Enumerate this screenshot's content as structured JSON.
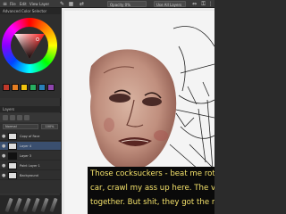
{
  "toolbar": {
    "items": [
      "File",
      "Edit",
      "View",
      "Layer"
    ],
    "opacity_label": "Opacity 0%",
    "mode_label": "Use All Layers"
  },
  "left_panel": {
    "color_header": "Advanced Color Selector",
    "layers_header": "Layers",
    "blend_mode": "Normal",
    "opacity": "100%",
    "layers": [
      {
        "name": "Copy of Face",
        "selected": false,
        "dark": false
      },
      {
        "name": "Layer 4",
        "selected": true,
        "dark": false
      },
      {
        "name": "Layer 3",
        "selected": false,
        "dark": true
      },
      {
        "name": "Paint Layer 1",
        "selected": false,
        "dark": false
      },
      {
        "name": "Background",
        "selected": false,
        "dark": false
      }
    ]
  },
  "swatch_colors": [
    "#c0392b",
    "#e67e22",
    "#f1c40f",
    "#27ae60",
    "#2980b9",
    "#8e44ad"
  ],
  "subtitle": {
    "lines": [
      "Those cocksuckers - beat me rotten,",
      "car, crawl my ass up here. The vamp",
      "together. But shit, they got the mone"
    ],
    "color": "#f2e06a"
  }
}
